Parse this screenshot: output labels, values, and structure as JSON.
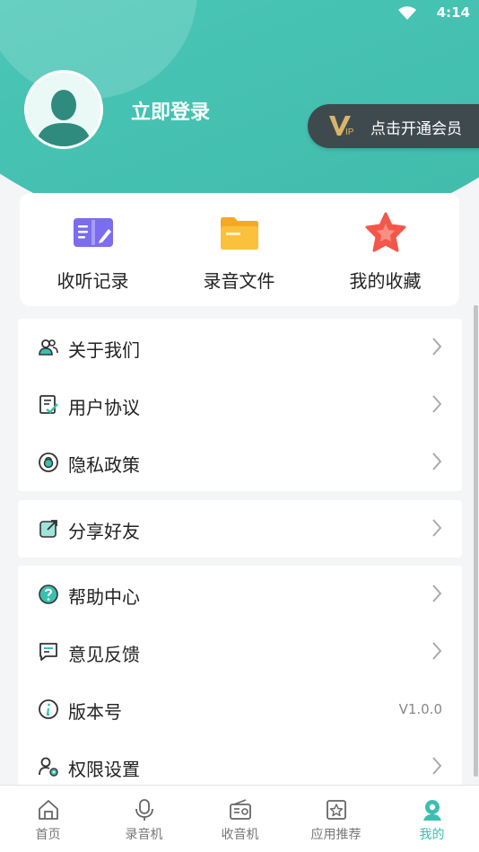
{
  "status_bar": {
    "time": "4:14"
  },
  "profile": {
    "login_label": "立即登录"
  },
  "vip": {
    "label": "点击开通会员"
  },
  "quick_actions": [
    {
      "label": "收听记录",
      "icon": "book-icon"
    },
    {
      "label": "录音文件",
      "icon": "folder-icon"
    },
    {
      "label": "我的收藏",
      "icon": "star-icon"
    }
  ],
  "menu_group_1": [
    {
      "label": "关于我们",
      "icon": "users-icon"
    },
    {
      "label": "用户协议",
      "icon": "document-check-icon"
    },
    {
      "label": "隐私政策",
      "icon": "privacy-icon"
    }
  ],
  "menu_group_2": [
    {
      "label": "分享好友",
      "icon": "share-icon"
    }
  ],
  "menu_group_3": [
    {
      "label": "帮助中心",
      "icon": "help-icon"
    },
    {
      "label": "意见反馈",
      "icon": "feedback-icon"
    },
    {
      "label": "版本号",
      "icon": "info-icon",
      "value": "V1.0.0"
    },
    {
      "label": "权限设置",
      "icon": "permission-icon"
    }
  ],
  "tabs": [
    {
      "label": "首页",
      "icon": "home-icon"
    },
    {
      "label": "录音机",
      "icon": "microphone-icon"
    },
    {
      "label": "收音机",
      "icon": "radio-icon"
    },
    {
      "label": "应用推荐",
      "icon": "app-recommend-icon"
    },
    {
      "label": "我的",
      "icon": "profile-icon",
      "active": true
    }
  ],
  "colors": {
    "accent": "#3cbfae",
    "header": "#4cc8b8",
    "vip_bg": "#3f4a4e"
  }
}
